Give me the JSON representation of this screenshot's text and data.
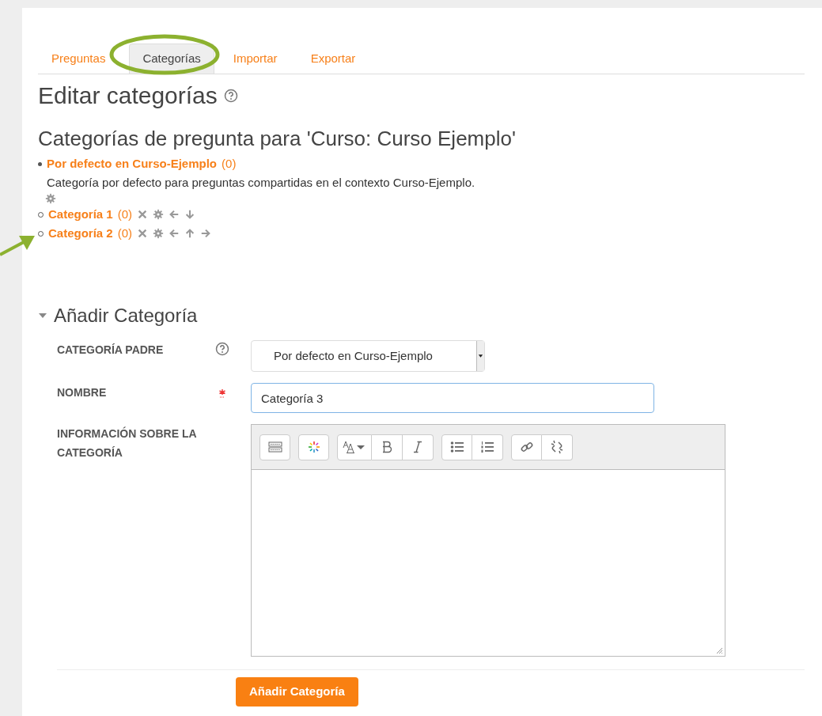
{
  "tabs": [
    {
      "label": "Preguntas",
      "selected": false
    },
    {
      "label": "Categorías",
      "selected": true
    },
    {
      "label": "Importar",
      "selected": false
    },
    {
      "label": "Exportar",
      "selected": false
    }
  ],
  "heading": {
    "title": "Editar categorías",
    "help": true
  },
  "subheading": "Categorías de pregunta para 'Curso: Curso Ejemplo'",
  "categories": [
    {
      "name": "Por defecto en Curso-Ejemplo",
      "count": "(0)",
      "description": "Categoría por defecto para preguntas compartidas en el contexto Curso-Ejemplo.",
      "editable": true,
      "children": [
        {
          "name": "Categoría 1",
          "count": "(0)",
          "deletable": true,
          "editable": true,
          "move_left": true,
          "move_down": true
        },
        {
          "name": "Categoría 2",
          "count": "(0)",
          "deletable": true,
          "editable": true,
          "move_left": true,
          "move_up": true,
          "move_right": true
        }
      ]
    }
  ],
  "form": {
    "title": "Añadir Categoría",
    "expanded": true,
    "fields": [
      {
        "kind": "select",
        "label": "CATEGORÍA PADRE",
        "help": true,
        "value": "Por defecto en Curso-Ejemplo"
      },
      {
        "kind": "text",
        "label": "NOMBRE",
        "required": true,
        "value": "Categoría 3"
      },
      {
        "kind": "editor",
        "label": "INFORMACIÓN SOBRE LA CATEGORÍA"
      }
    ],
    "submit": "Añadir Categoría"
  }
}
